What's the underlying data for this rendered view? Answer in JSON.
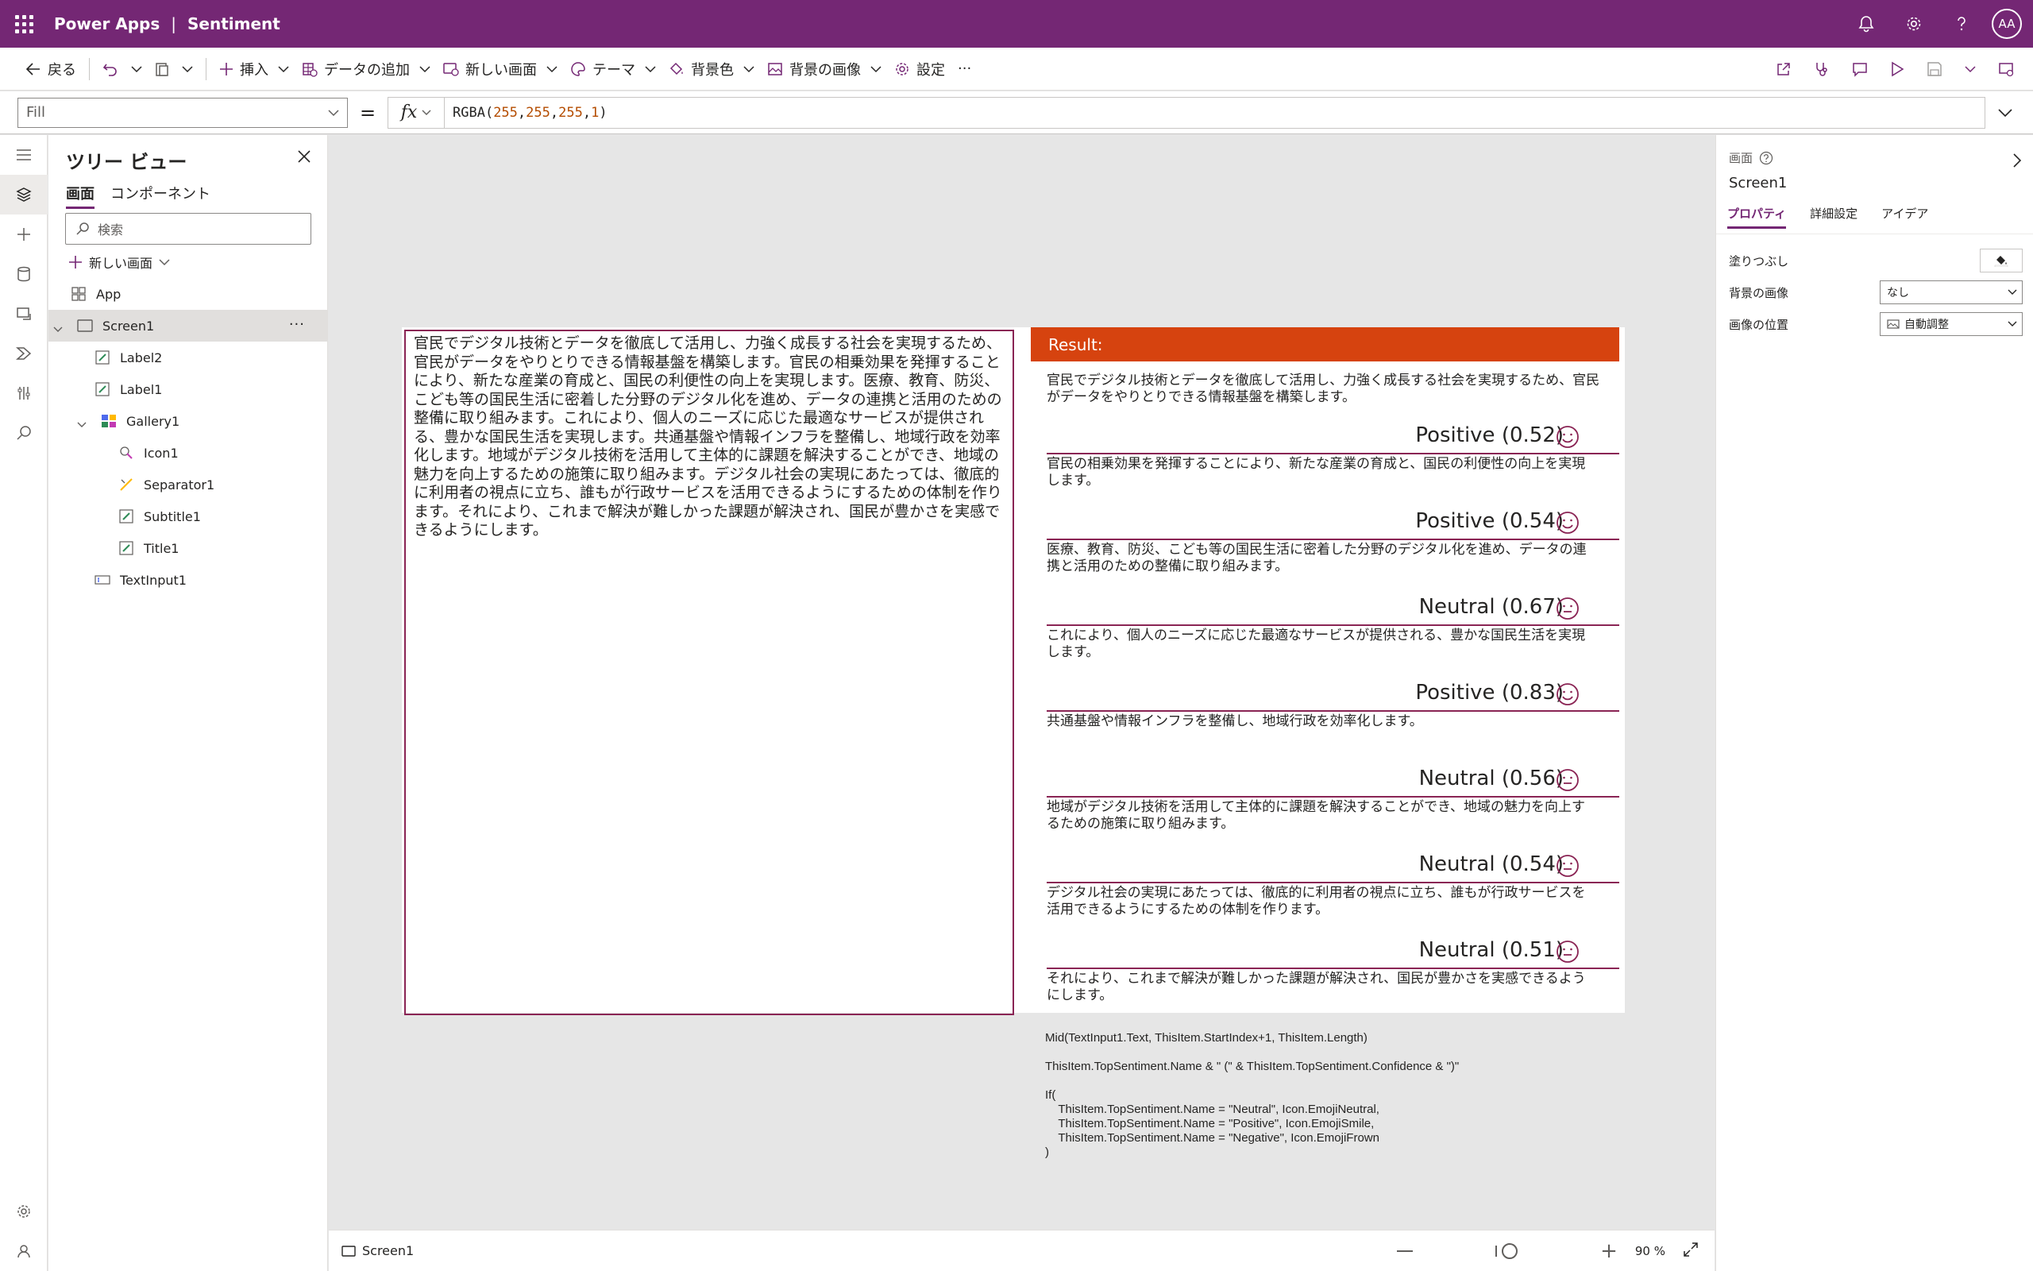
{
  "topbar": {
    "app_name": "Power Apps",
    "separator": "|",
    "doc_name": "Sentiment",
    "avatar_initials": "AA"
  },
  "command_bar": {
    "back": "戻る",
    "insert": "挿入",
    "add_data": "データの追加",
    "new_screen": "新しい画面",
    "theme": "テーマ",
    "background_color": "背景色",
    "background_image": "背景の画像",
    "settings": "設定",
    "more": "···"
  },
  "formula_bar": {
    "property": "Fill",
    "equals": "=",
    "fx": "fx",
    "formula_fn": "RGBA(",
    "formula_args": [
      "255",
      "255",
      "255",
      "1"
    ],
    "formula_close": ")"
  },
  "tree_view": {
    "title": "ツリー ビュー",
    "tabs": [
      "画面",
      "コンポーネント"
    ],
    "search_placeholder": "検索",
    "new_screen": "新しい画面",
    "items": [
      {
        "label": "App",
        "type": "app",
        "indent": 0
      },
      {
        "label": "Screen1",
        "type": "screen",
        "indent": 0,
        "selected": true
      },
      {
        "label": "Label2",
        "type": "label",
        "indent": 1
      },
      {
        "label": "Label1",
        "type": "label",
        "indent": 1
      },
      {
        "label": "Gallery1",
        "type": "gallery",
        "indent": 1
      },
      {
        "label": "Icon1",
        "type": "icon",
        "indent": 2
      },
      {
        "label": "Separator1",
        "type": "separator",
        "indent": 2
      },
      {
        "label": "Subtitle1",
        "type": "label",
        "indent": 2
      },
      {
        "label": "Title1",
        "type": "label",
        "indent": 2
      },
      {
        "label": "TextInput1",
        "type": "textinput",
        "indent": 1
      }
    ],
    "more": "···"
  },
  "canvas": {
    "text_input": "官民でデジタル技術とデータを徹底して活用し、力強く成長する社会を実現するため、官民がデータをやりとりできる情報基盤を構築します。官民の相乗効果を発揮することにより、新たな産業の育成と、国民の利便性の向上を実現します。医療、教育、防災、こども等の国民生活に密着した分野のデジタル化を進め、データの連携と活用のための整備に取り組みます。これにより、個人のニーズに応じた最適なサービスが提供される、豊かな国民生活を実現します。共通基盤や情報インフラを整備し、地域行政を効率化します。地域がデジタル技術を活用して主体的に課題を解決することができ、地域の魅力を向上するための施策に取り組みます。デジタル社会の実現にあたっては、徹底的に利用者の視点に立ち、誰もが行政サービスを活用できるようにするための体制を作ります。それにより、これまで解決が難しかった課題が解決され、国民が豊かさを実感できるようにします。",
    "result_header": "Result:",
    "result_intro": "官民でデジタル技術とデータを徹底して活用し、力強く成長する社会を実現するため、官民がデータをやりとりできる情報基盤を構築します。",
    "gallery": [
      {
        "title": "Positive (0.52)",
        "subtitle": "官民の相乗効果を発揮することにより、新たな産業の育成と、国民の利便性の向上を実現します。",
        "icon": "smile-icon"
      },
      {
        "title": "Positive (0.54)",
        "subtitle": "医療、教育、防災、こども等の国民生活に密着した分野のデジタル化を進め、データの連携と活用のための整備に取り組みます。",
        "icon": "smile-icon"
      },
      {
        "title": "Neutral (0.67)",
        "subtitle": "これにより、個人のニーズに応じた最適なサービスが提供される、豊かな国民生活を実現します。",
        "icon": "neutral-icon"
      },
      {
        "title": "Positive (0.83)",
        "subtitle": "共通基盤や情報インフラを整備し、地域行政を効率化します。",
        "icon": "smile-icon"
      },
      {
        "title": "Neutral (0.56)",
        "subtitle": "地域がデジタル技術を活用して主体的に課題を解決することができ、地域の魅力を向上するための施策に取り組みます。",
        "icon": "neutral-icon"
      },
      {
        "title": "Neutral (0.54)",
        "subtitle": "デジタル社会の実現にあたっては、徹底的に利用者の視点に立ち、誰もが行政サービスを活用できるようにするための体制を作ります。",
        "icon": "neutral-icon"
      },
      {
        "title": "Neutral (0.51)",
        "subtitle": "それにより、これまで解決が難しかった課題が解決され、国民が豊かさを実感できるようにします。",
        "icon": "neutral-icon"
      }
    ],
    "notes": "Mid(TextInput1.Text, ThisItem.StartIndex+1, ThisItem.Length)\n\nThisItem.TopSentiment.Name & \" (\" & ThisItem.TopSentiment.Confidence & \")\"\n\nIf(\n    ThisItem.TopSentiment.Name = \"Neutral\", Icon.EmojiNeutral,\n    ThisItem.TopSentiment.Name = \"Positive\", Icon.EmojiSmile,\n    ThisItem.TopSentiment.Name = \"Negative\", Icon.EmojiFrown\n)"
  },
  "status_bar": {
    "screen": "Screen1",
    "zoom": "90",
    "zoom_unit": "%"
  },
  "properties": {
    "type": "画面",
    "name": "Screen1",
    "tabs": [
      "プロパティ",
      "詳細設定",
      "アイデア"
    ],
    "fill_label": "塗りつぶし",
    "bg_image_label": "背景の画像",
    "bg_image_value": "なし",
    "image_position_label": "画像の位置",
    "image_position_value": "自動調整"
  },
  "colors": {
    "brand": "#742774",
    "result_header": "#d6430f",
    "separator": "#8a2454"
  }
}
